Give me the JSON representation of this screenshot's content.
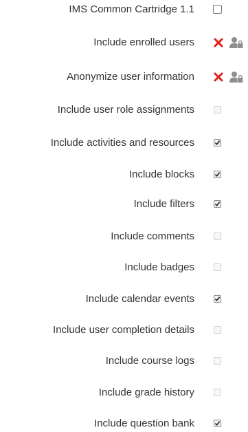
{
  "settings": [
    {
      "label": "IMS Common Cartridge 1.1",
      "state": "unchecked",
      "style": "big"
    },
    {
      "label": "Include enrolled users",
      "state": "locked"
    },
    {
      "label": "Anonymize user information",
      "state": "locked"
    },
    {
      "label": "Include user role assignments",
      "state": "disabled"
    },
    {
      "label": "Include activities and resources",
      "state": "checked"
    },
    {
      "label": "Include blocks",
      "state": "checked"
    },
    {
      "label": "Include filters",
      "state": "checked"
    },
    {
      "label": "Include comments",
      "state": "disabled"
    },
    {
      "label": "Include badges",
      "state": "disabled"
    },
    {
      "label": "Include calendar events",
      "state": "checked"
    },
    {
      "label": "Include user completion details",
      "state": "disabled"
    },
    {
      "label": "Include course logs",
      "state": "disabled"
    },
    {
      "label": "Include grade history",
      "state": "disabled"
    },
    {
      "label": "Include question bank",
      "state": "checked"
    }
  ],
  "colors": {
    "text": "#333333",
    "cross": "#e0201b",
    "lock_icon": "#8f8f8f"
  },
  "icons": {
    "locked_setting": "cross-icon",
    "locked_by": "user-lock-icon"
  }
}
